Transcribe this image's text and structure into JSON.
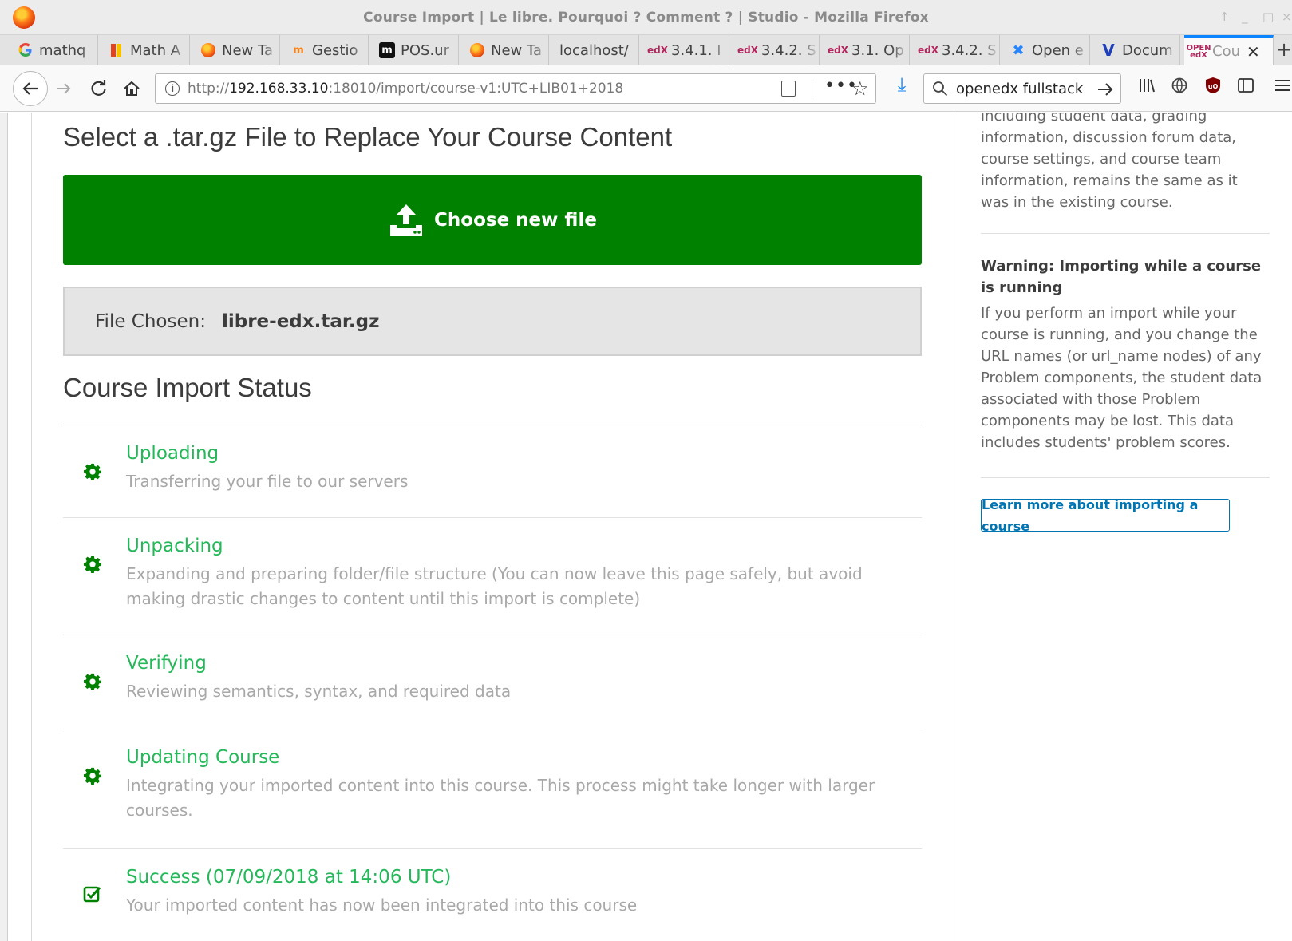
{
  "window": {
    "title": "Course Import | Le libre. Pourquoi ? Comment ? | Studio - Mozilla Firefox"
  },
  "tabs": [
    {
      "label": "mathq",
      "favicon": "google-icon"
    },
    {
      "label": "Math A",
      "favicon": "bookmark-icon"
    },
    {
      "label": "New Ta",
      "favicon": "firefox-icon"
    },
    {
      "label": "Gestio",
      "favicon": "moodle-icon"
    },
    {
      "label": "POS.ur",
      "favicon": "m-icon"
    },
    {
      "label": "New Ta",
      "favicon": "firefox-icon"
    },
    {
      "label": "localhost/",
      "favicon": ""
    },
    {
      "label": "3.4.1. I",
      "favicon": "edx-icon"
    },
    {
      "label": "3.4.2. S",
      "favicon": "edx-icon"
    },
    {
      "label": "3.1. Op",
      "favicon": "edx-icon"
    },
    {
      "label": "3.4.2. S",
      "favicon": "edx-icon"
    },
    {
      "label": "Open e",
      "favicon": "confluence-icon"
    },
    {
      "label": "Docum",
      "favicon": "v-icon"
    },
    {
      "label": "Cou",
      "favicon": "openedx-icon",
      "active": true
    }
  ],
  "navbar": {
    "url_prefix": "http://",
    "url_host": "192.168.33.10",
    "url_rest": ":18010/import/course-v1:UTC+LIB01+2018",
    "search_value": "openedx fullstack"
  },
  "page": {
    "select_title": "Select a .tar.gz File to Replace Your Course Content",
    "choose_button": "Choose new file",
    "file_chosen_label": "File Chosen:",
    "file_chosen_name": "libre-edx.tar.gz",
    "status_title": "Course Import Status",
    "steps": [
      {
        "title": "Uploading",
        "desc": "Transferring your file to our servers",
        "icon": "gear-icon"
      },
      {
        "title": "Unpacking",
        "desc": "Expanding and preparing folder/file structure (You can now leave this page safely, but avoid making drastic changes to content until this import is complete)",
        "icon": "gear-icon"
      },
      {
        "title": "Verifying",
        "desc": "Reviewing semantics, syntax, and required data",
        "icon": "gear-icon"
      },
      {
        "title": "Updating Course",
        "desc": "Integrating your imported content into this course. This process might take longer with larger courses.",
        "icon": "gear-icon"
      },
      {
        "title": "Success  (07/09/2018 at 14:06 UTC)",
        "desc": "Your imported content has now been integrated into this course",
        "icon": "checkbox-icon"
      }
    ]
  },
  "sidebar": {
    "intro_text": "including student data, grading information, discussion forum data, course settings, and course team information, remains the same as it was in the existing course.",
    "warning_heading": "Warning: Importing while a course is running",
    "warning_text": "If you perform an import while your course is running, and you change the URL names (or url_name nodes) of any Problem components, the student data associated with those Problem components may be lost. This data includes students' problem scores.",
    "learn_more": "Learn more about importing a course"
  },
  "colors": {
    "green_button": "#008100",
    "status_green": "#25b85a",
    "link_blue": "#0075b4",
    "tab_accent": "#0a84ff"
  }
}
